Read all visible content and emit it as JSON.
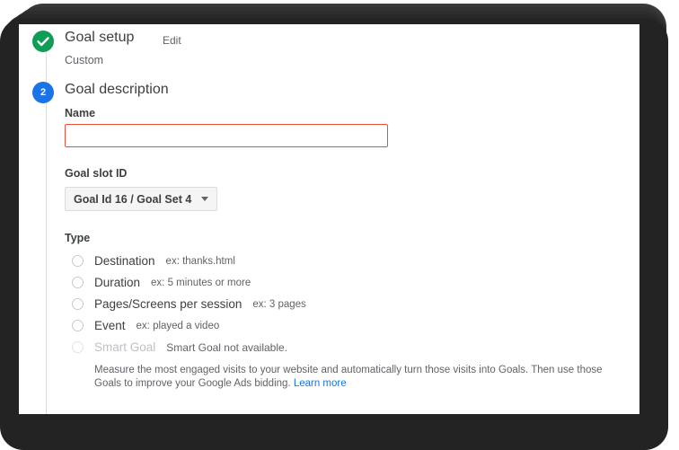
{
  "steps": [
    {
      "id": "goal-setup",
      "state": "completed",
      "marker": "check",
      "title": "Goal setup",
      "edit_label": "Edit",
      "subtitle": "Custom"
    },
    {
      "id": "goal-description",
      "state": "active",
      "marker": "2",
      "title": "Goal description"
    }
  ],
  "form": {
    "name": {
      "label": "Name",
      "value": "",
      "placeholder": "",
      "invalid": true
    },
    "goal_slot": {
      "label": "Goal slot ID",
      "selected": "Goal Id 16 / Goal Set 4"
    },
    "type": {
      "label": "Type",
      "options": [
        {
          "label": "Destination",
          "hint": "ex: thanks.html",
          "selected": false,
          "disabled": false
        },
        {
          "label": "Duration",
          "hint": "ex: 5 minutes or more",
          "selected": false,
          "disabled": false
        },
        {
          "label": "Pages/Screens per session",
          "hint": "ex: 3 pages",
          "selected": false,
          "disabled": false
        },
        {
          "label": "Event",
          "hint": "ex: played a video",
          "selected": false,
          "disabled": false
        },
        {
          "label": "Smart Goal",
          "hint": "Smart Goal not available.",
          "selected": false,
          "disabled": true
        }
      ]
    },
    "smart_goal_description": {
      "text": "Measure the most engaged visits to your website and automatically turn those visits into Goals. Then use those Goals to improve your Google Ads bidding.",
      "link_label": "Learn more"
    }
  },
  "colors": {
    "step_completed": "#0F9D58",
    "step_active": "#1A73E8",
    "error_border": "#E8503A",
    "link": "#1A73E8",
    "text_primary": "#3C4043",
    "text_secondary": "#5F6368",
    "text_disabled": "#BDC1C6"
  }
}
